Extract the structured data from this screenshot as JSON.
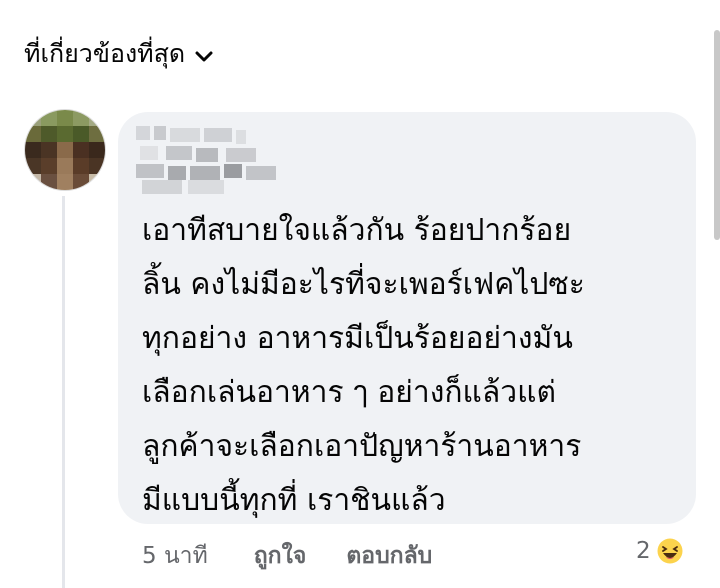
{
  "sort": {
    "label": "ที่เกี่ยวข้องที่สุด",
    "icon": "chevron-down-icon"
  },
  "comment": {
    "author_avatar": "blurred-avatar",
    "author_name_blurred": true,
    "lines": [
      "เอาทีสบายใจแล้วกัน ร้อยปากร้อย",
      "ลิ้น คงไม่มีอะไรที่จะเพอร์เฟคไปซะ",
      "ทุกอย่าง อาหารมีเป็นร้อยอย่างมัน",
      "เลือกเล่นอาหาร ๅ อย่างก็แล้วแต่",
      "ลูกค้าจะเลือกเอาปัญหาร้านอาหาร",
      "มีแบบนี้ทุกที่ เราชินแล้ว"
    ],
    "bubble_color": "#f0f2f5"
  },
  "actions": {
    "timestamp": "5 นาที",
    "like_label": "ถูกใจ",
    "reply_label": "ตอบกลับ"
  },
  "reactions": {
    "count": "2",
    "icon": "haha-emoji-icon"
  },
  "colors": {
    "text": "#050505",
    "secondary": "#65676b",
    "thread_line": "#e4e6eb"
  }
}
